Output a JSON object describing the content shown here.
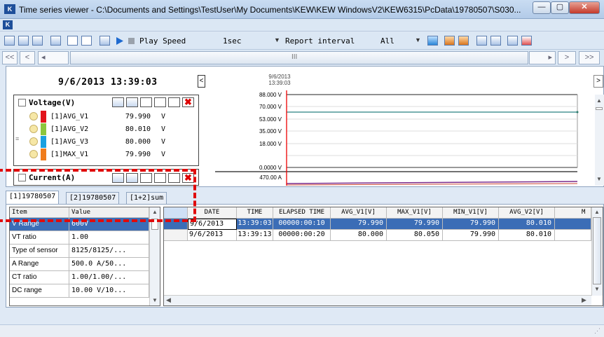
{
  "window": {
    "title": "Time series viewer - C:\\Documents and Settings\\TestUser\\My Documents\\KEW\\KEW WindowsV2\\KEW6315\\PcData\\19780507\\S030...",
    "app_icon": "kew-logo",
    "minimize": "—",
    "maximize": "▢",
    "close": "✕"
  },
  "toolbar": {
    "play_speed_label": "Play Speed",
    "play_speed_value": "1sec",
    "report_interval_label": "Report interval",
    "report_interval_value": "All",
    "play_icon": "play-icon",
    "stop_icon": "stop-icon"
  },
  "navigation": {
    "first": "<<",
    "prev": "<",
    "left": "◂",
    "right": "▸",
    "next": ">",
    "last": ">>",
    "grip": "III"
  },
  "viewer": {
    "timestamp": "9/6/2013  13:39:03",
    "cursor_date": "9/6/2013",
    "cursor_time": "13:39:03",
    "cursor_button": "<",
    "right_arrow": ">"
  },
  "voltage_group": {
    "title": "Voltage(V)",
    "channels": [
      {
        "name": "[1]AVG_V1",
        "value": "79.990",
        "unit": "V",
        "color": "#e2141c"
      },
      {
        "name": "[1]AVG_V2",
        "value": "80.010",
        "unit": "V",
        "color": "#8cc63e"
      },
      {
        "name": "[1]AVG_V3",
        "value": "80.000",
        "unit": "V",
        "color": "#1aa0e0"
      },
      {
        "name": "[1]MAX_V1",
        "value": "79.990",
        "unit": "V",
        "color": "#f07c1c"
      }
    ],
    "y_ticks": [
      "88.000 V",
      "70.000 V",
      "53.000 V",
      "35.000 V",
      "18.000 V",
      "0.0000 V"
    ]
  },
  "current_group": {
    "title": "Current(A)",
    "y_ticks": [
      "470.00 A"
    ]
  },
  "tabs": [
    "[1]19780507",
    "[2]19780507",
    "[1+2]sum"
  ],
  "properties": {
    "headers": [
      "Item",
      "Value"
    ],
    "rows": [
      {
        "item": "V Range",
        "value": "600V"
      },
      {
        "item": "VT ratio",
        "value": "1.00"
      },
      {
        "item": "Type of sensor",
        "value": "8125/8125/..."
      },
      {
        "item": "A Range",
        "value": "500.0 A/50..."
      },
      {
        "item": "CT ratio",
        "value": "1.00/1.00/..."
      },
      {
        "item": "DC range",
        "value": "10.00 V/10..."
      }
    ]
  },
  "data_table": {
    "headers": [
      "DATE",
      "TIME",
      "ELAPSED TIME",
      "AVG_V1[V]",
      "MAX_V1[V]",
      "MIN_V1[V]",
      "AVG_V2[V]",
      "M"
    ],
    "rows": [
      [
        "9/6/2013",
        "13:39:03",
        "00000:00:10",
        "79.990",
        "79.990",
        "79.990",
        "80.010"
      ],
      [
        "9/6/2013",
        "13:39:13",
        "00000:00:20",
        "80.000",
        "80.050",
        "79.990",
        "80.010"
      ]
    ]
  }
}
